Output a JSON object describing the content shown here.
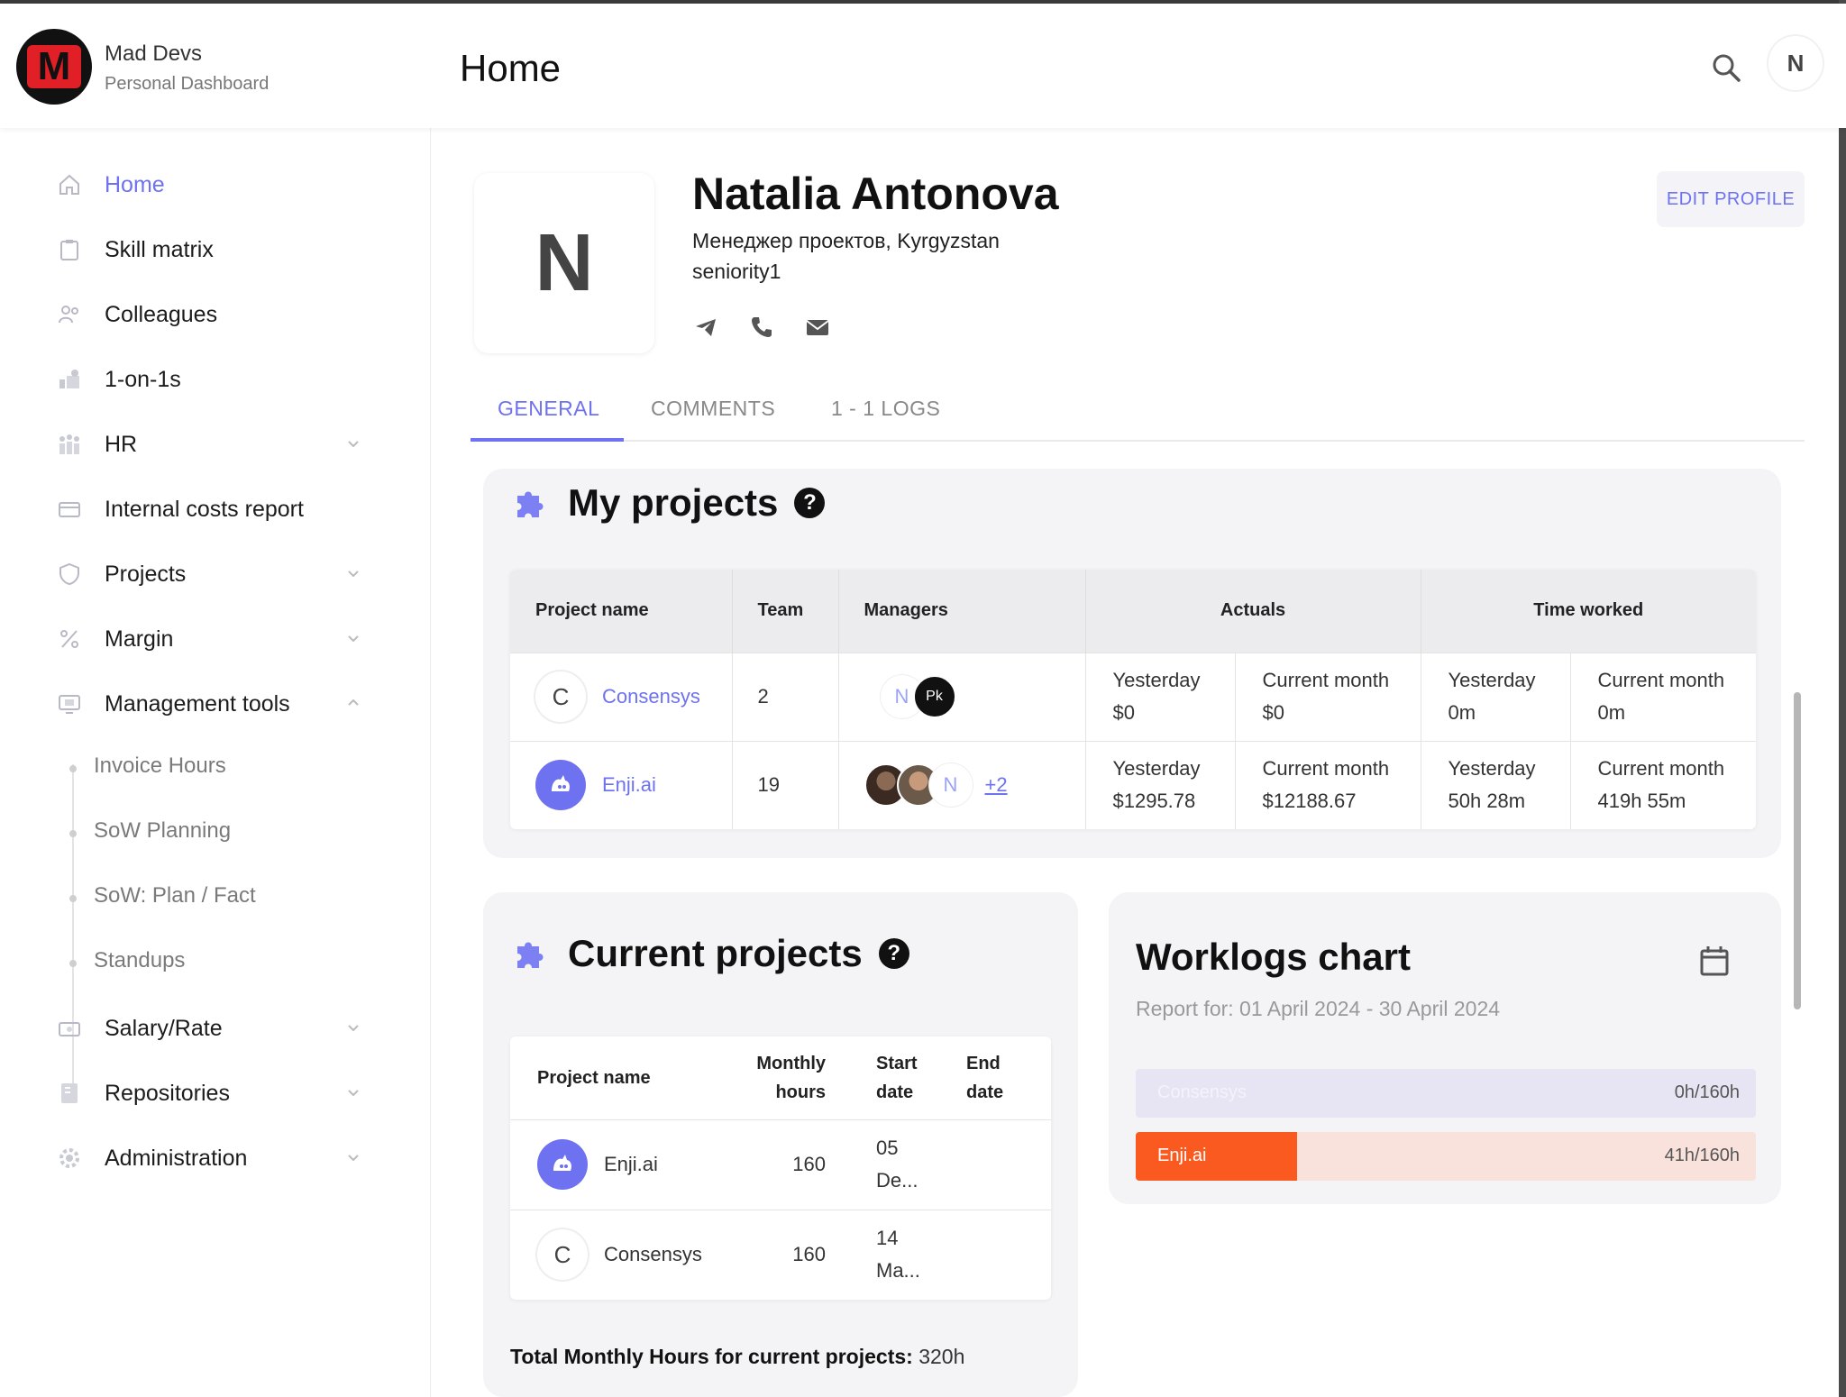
{
  "header": {
    "brand_name": "Mad Devs",
    "brand_sub": "Personal Dashboard",
    "page_title": "Home",
    "avatar_letter": "N"
  },
  "sidebar": {
    "items": [
      {
        "label": "Home",
        "icon": "home-icon"
      },
      {
        "label": "Skill matrix",
        "icon": "clipboard-icon"
      },
      {
        "label": "Colleagues",
        "icon": "people-icon"
      },
      {
        "label": "1-on-1s",
        "icon": "handshake-icon"
      },
      {
        "label": "HR",
        "icon": "hr-icon"
      },
      {
        "label": "Internal costs report",
        "icon": "card-icon"
      },
      {
        "label": "Projects",
        "icon": "shield-icon"
      },
      {
        "label": "Margin",
        "icon": "percent-icon"
      },
      {
        "label": "Management tools",
        "icon": "monitor-icon"
      },
      {
        "label": "Salary/Rate",
        "icon": "cash-icon"
      },
      {
        "label": "Repositories",
        "icon": "repo-icon"
      },
      {
        "label": "Administration",
        "icon": "gear-icon"
      }
    ],
    "sub_items": [
      "Invoice Hours",
      "SoW Planning",
      "SoW: Plan / Fact",
      "Standups"
    ]
  },
  "profile": {
    "initial": "N",
    "name": "Natalia Antonova",
    "role": "Менеджер проектов, Kyrgyzstan",
    "seniority": "seniority1",
    "edit_label": "EDIT PROFILE"
  },
  "tabs": [
    "GENERAL",
    "COMMENTS",
    "1 - 1 LOGS"
  ],
  "my_projects": {
    "title": "My projects",
    "headers": [
      "Project name",
      "Team",
      "Managers",
      "Actuals",
      "Time worked"
    ],
    "rows": [
      {
        "logo": "C",
        "name": "Consensys",
        "team": "2",
        "a_y_label": "Yesterday",
        "a_y_val": "$0",
        "a_m_label": "Current month",
        "a_m_val": "$0",
        "t_y_label": "Yesterday",
        "t_y_val": "0m",
        "t_m_label": "Current month",
        "t_m_val": "0m"
      },
      {
        "logo": "enji-logo",
        "name": "Enji.ai",
        "team": "19",
        "more": "+2",
        "a_y_label": "Yesterday",
        "a_y_val": "$1295.78",
        "a_m_label": "Current month",
        "a_m_val": "$12188.67",
        "t_y_label": "Yesterday",
        "t_y_val": "50h 28m",
        "t_m_label": "Current month",
        "t_m_val": "419h 55m"
      }
    ]
  },
  "current_projects": {
    "title": "Current projects",
    "headers": {
      "name": "Project name",
      "monthly_1": "Monthly",
      "monthly_2": "hours",
      "start_1": "Start",
      "start_2": "date",
      "end_1": "End",
      "end_2": "date"
    },
    "rows": [
      {
        "logo": "enji-logo",
        "name": "Enji.ai",
        "hours": "160",
        "start_1": "05",
        "start_2": "De...",
        "end": ""
      },
      {
        "logo": "C",
        "name": "Consensys",
        "hours": "160",
        "start_1": "14",
        "start_2": "Ma...",
        "end": ""
      }
    ],
    "total_label": "Total Monthly Hours for current projects:",
    "total_value": " 320h"
  },
  "worklogs": {
    "title": "Worklogs chart",
    "subtitle": "Report for: 01 April 2024 - 30 April 2024",
    "bars": [
      {
        "name": "Consensys",
        "value": "0h/160h",
        "fraction": 0.0,
        "color": "#7c80f2",
        "track": "#e7e5f3"
      },
      {
        "name": "Enji.ai",
        "value": "41h/160h",
        "fraction": 0.26,
        "color": "#fa5a20",
        "track": "#f9e2db"
      }
    ]
  },
  "colors": {
    "accent": "#6e72f0",
    "orange": "#fa5a20",
    "card_bg": "#f4f4f6"
  }
}
